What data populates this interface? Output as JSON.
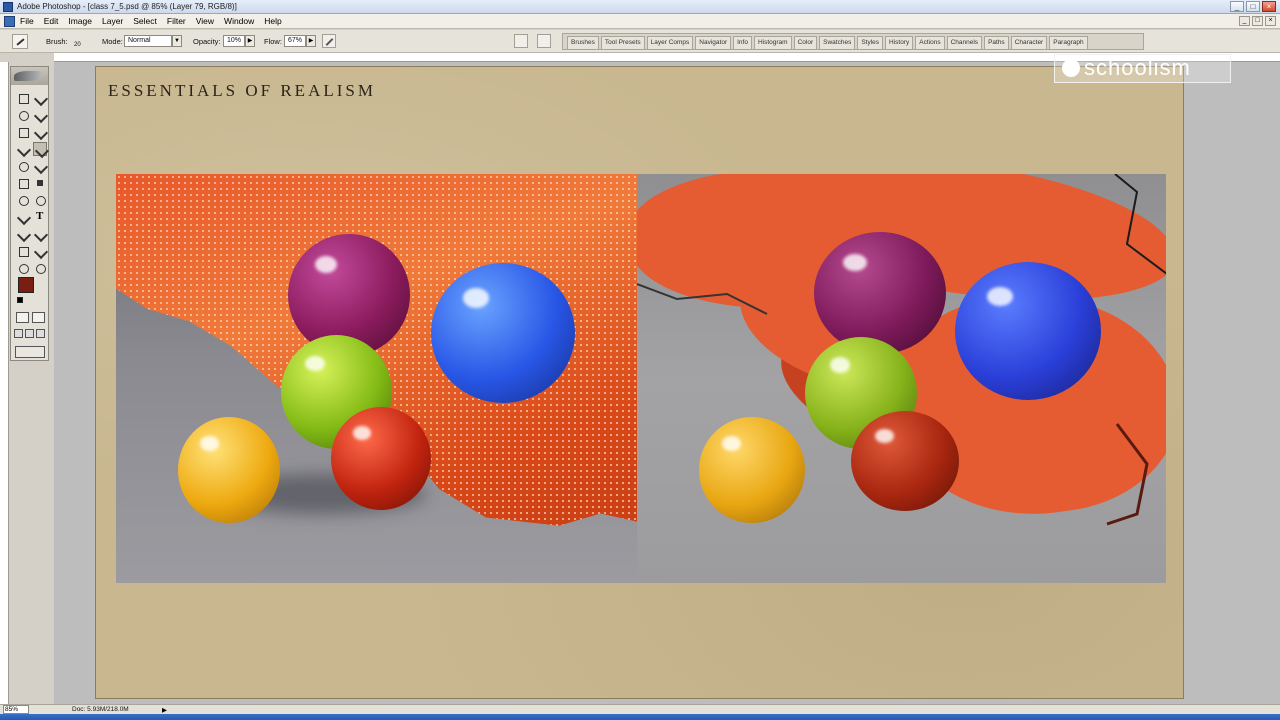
{
  "window": {
    "title": "Adobe Photoshop - [class 7_5.psd @ 85% (Layer 79, RGB/8)]",
    "controls": [
      "_",
      "□",
      "×"
    ]
  },
  "menu": {
    "items": [
      "File",
      "Edit",
      "Image",
      "Layer",
      "Select",
      "Filter",
      "View",
      "Window",
      "Help"
    ]
  },
  "options": {
    "brush_label": "Brush:",
    "brush_size": "20",
    "mode_label": "Mode:",
    "mode_value": "Normal",
    "opacity_label": "Opacity:",
    "opacity_value": "10%",
    "flow_label": "Flow:",
    "flow_value": "67%"
  },
  "palette_well": {
    "tabs": [
      "Brushes",
      "Tool Presets",
      "Layer Comps",
      "Navigator",
      "Info",
      "Histogram",
      "Color",
      "Swatches",
      "Styles",
      "History",
      "Actions",
      "Channels",
      "Paths",
      "Character",
      "Paragraph"
    ]
  },
  "document": {
    "heading": "ESSENTIALS OF REALISM",
    "logo_text": "schoolism"
  },
  "colors": {
    "foreground": "#7a1d12",
    "background": "#ffffff"
  },
  "status": {
    "zoom": "85%",
    "doc_size": "Doc: 5.93M/218.0M"
  }
}
